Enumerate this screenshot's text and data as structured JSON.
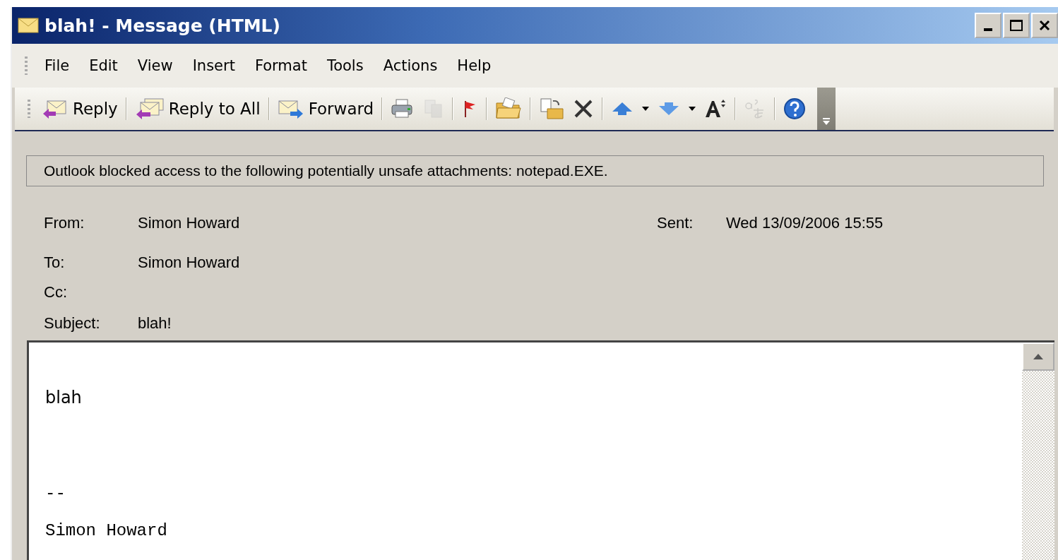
{
  "window": {
    "title": "blah!  - Message (HTML)"
  },
  "menu": [
    {
      "label": "File"
    },
    {
      "label": "Edit"
    },
    {
      "label": "View"
    },
    {
      "label": "Insert"
    },
    {
      "label": "Format"
    },
    {
      "label": "Tools"
    },
    {
      "label": "Actions"
    },
    {
      "label": "Help"
    }
  ],
  "toolbar": [
    {
      "kind": "text-button",
      "label": "Reply",
      "disabled": false
    },
    {
      "kind": "separator"
    },
    {
      "kind": "text-button",
      "label": "Reply to All",
      "disabled": false
    },
    {
      "kind": "separator"
    },
    {
      "kind": "text-button",
      "label": "Forward",
      "disabled": false
    },
    {
      "kind": "separator"
    },
    {
      "kind": "icon-button",
      "disabled": false
    },
    {
      "kind": "icon-button",
      "disabled": true
    },
    {
      "kind": "separator"
    },
    {
      "kind": "icon-button",
      "disabled": false
    },
    {
      "kind": "separator"
    },
    {
      "kind": "icon-button",
      "disabled": false
    },
    {
      "kind": "separator"
    },
    {
      "kind": "icon-button",
      "disabled": false
    },
    {
      "kind": "icon-button",
      "disabled": false
    },
    {
      "kind": "separator"
    },
    {
      "kind": "icon-button",
      "disabled": false
    },
    {
      "kind": "dropdown"
    },
    {
      "kind": "icon-button",
      "disabled": false
    },
    {
      "kind": "dropdown"
    },
    {
      "kind": "icon-button",
      "disabled": false
    },
    {
      "kind": "separator"
    },
    {
      "kind": "icon-button",
      "disabled": true
    },
    {
      "kind": "separator"
    },
    {
      "kind": "icon-button",
      "disabled": false
    }
  ],
  "info_bar": "Outlook blocked access to the following potentially unsafe attachments: notepad.EXE.",
  "headers": {
    "from_label": "From:",
    "from": "Simon Howard",
    "sent_label": "Sent:",
    "sent": "Wed 13/09/2006 15:55",
    "to_label": "To:",
    "to": "Simon Howard",
    "cc_label": "Cc:",
    "subject_label": "Subject:",
    "subject": "blah!"
  },
  "body": [
    {
      "kind": "text",
      "text": "blah"
    },
    {
      "kind": "signature",
      "text": "--"
    },
    {
      "kind": "signature",
      "text": "Simon Howard"
    }
  ]
}
